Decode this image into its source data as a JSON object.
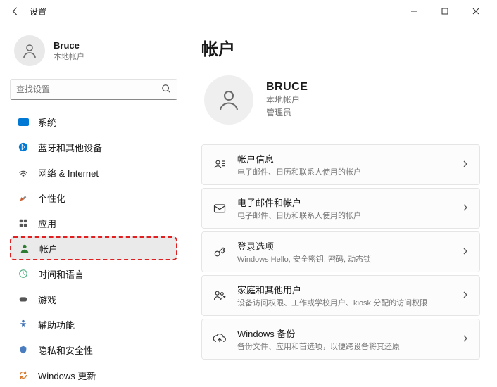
{
  "icons": {
    "system": "#0078d4",
    "account_accent": "#2e7d32"
  },
  "titlebar": {
    "title": "设置"
  },
  "user": {
    "name": "Bruce",
    "subtitle": "本地帐户"
  },
  "search": {
    "placeholder": "查找设置"
  },
  "nav": {
    "items": [
      {
        "label": "系统"
      },
      {
        "label": "蓝牙和其他设备"
      },
      {
        "label": "网络 & Internet"
      },
      {
        "label": "个性化"
      },
      {
        "label": "应用"
      },
      {
        "label": "帐户"
      },
      {
        "label": "时间和语言"
      },
      {
        "label": "游戏"
      },
      {
        "label": "辅助功能"
      },
      {
        "label": "隐私和安全性"
      },
      {
        "label": "Windows 更新"
      }
    ]
  },
  "page": {
    "title": "帐户"
  },
  "profile": {
    "name": "BRUCE",
    "line1": "本地帐户",
    "line2": "管理员"
  },
  "cards": [
    {
      "title": "帐户信息",
      "subtitle": "电子邮件、日历和联系人使用的帐户"
    },
    {
      "title": "电子邮件和帐户",
      "subtitle": "电子邮件、日历和联系人使用的帐户"
    },
    {
      "title": "登录选项",
      "subtitle": "Windows Hello, 安全密钥, 密码, 动态锁"
    },
    {
      "title": "家庭和其他用户",
      "subtitle": "设备访问权限、工作或学校用户、kiosk 分配的访问权限"
    },
    {
      "title": "Windows 备份",
      "subtitle": "备份文件、应用和首选项，以便跨设备将其还原"
    }
  ]
}
